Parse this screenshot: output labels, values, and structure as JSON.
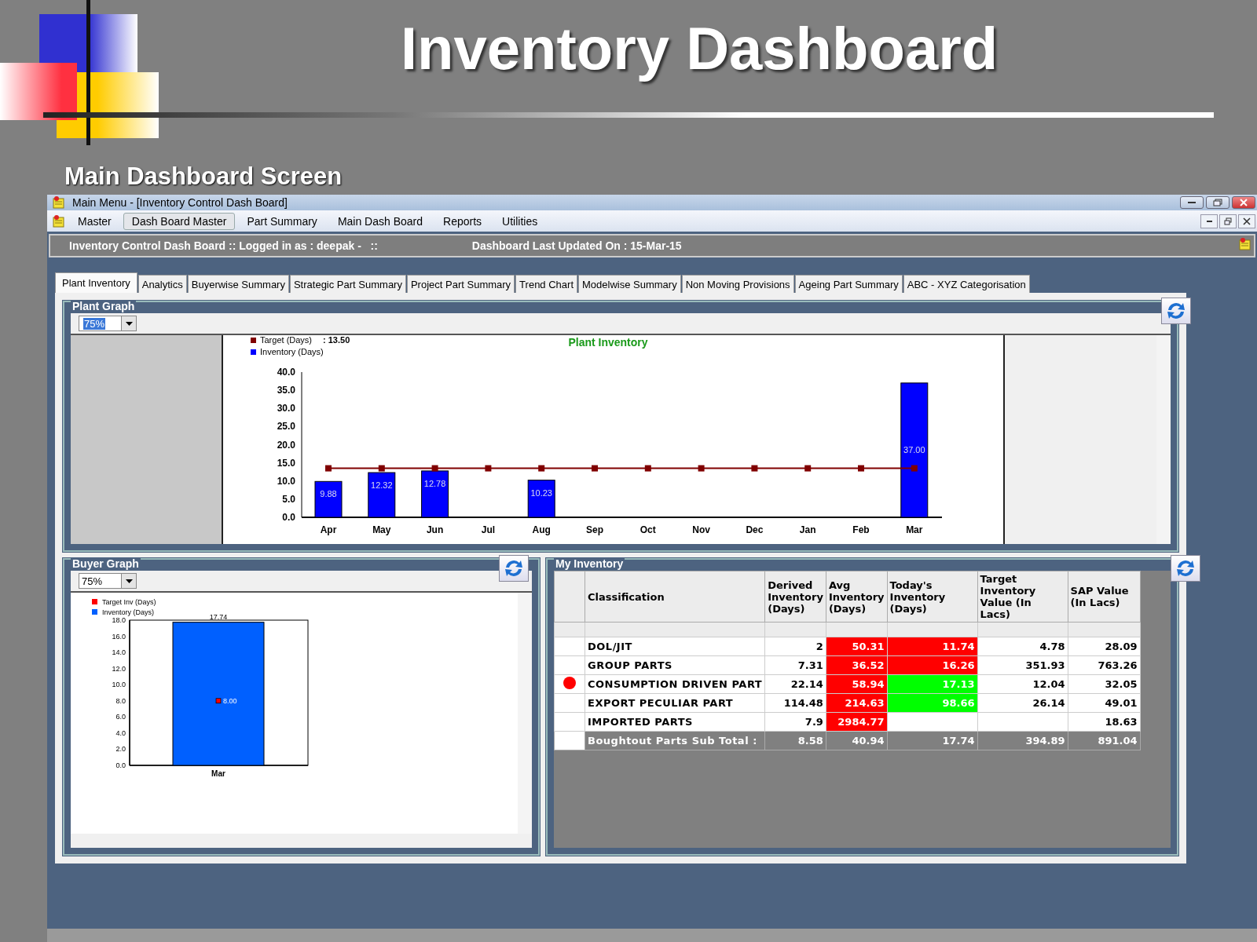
{
  "slide": {
    "title": "Inventory Dashboard",
    "subtitle": "Main Dashboard Screen"
  },
  "window": {
    "title": "Main Menu - [Inventory Control Dash Board]"
  },
  "menu": [
    {
      "label": "Master",
      "selected": false
    },
    {
      "label": "Dash Board Master",
      "selected": true
    },
    {
      "label": "Part Summary",
      "selected": false
    },
    {
      "label": "Main Dash Board",
      "selected": false
    },
    {
      "label": "Reports",
      "selected": false
    },
    {
      "label": "Utilities",
      "selected": false
    }
  ],
  "status_bar": {
    "login": "Inventory Control Dash Board :: Logged in as : deepak -   ::",
    "updated": "Dashboard Last Updated On : 15-Mar-15"
  },
  "tabs": [
    {
      "label": "Plant Inventory",
      "selected": true
    },
    {
      "label": "Analytics",
      "selected": false
    },
    {
      "label": "Buyerwise Summary",
      "selected": false
    },
    {
      "label": "Strategic Part Summary",
      "selected": false
    },
    {
      "label": "Project Part Summary",
      "selected": false
    },
    {
      "label": "Trend Chart",
      "selected": false
    },
    {
      "label": "Modelwise Summary",
      "selected": false
    },
    {
      "label": "Non Moving Provisions",
      "selected": false
    },
    {
      "label": "Ageing Part Summary",
      "selected": false
    },
    {
      "label": "ABC - XYZ Categorisation",
      "selected": false
    }
  ],
  "plant_graph": {
    "title": "Plant Graph",
    "zoom": "75%",
    "legend_values": [
      ": 13.50"
    ],
    "chart_data": {
      "type": "bar",
      "title": "Plant Inventory",
      "legend": "top left",
      "categories": [
        "Apr",
        "May",
        "Jun",
        "Jul",
        "Aug",
        "Sep",
        "Oct",
        "Nov",
        "Dec",
        "Jan",
        "Feb",
        "Mar"
      ],
      "series": [
        {
          "name": "Target (Days)",
          "color": "#800000",
          "type": "line",
          "marker": "square",
          "values": [
            13.5,
            13.5,
            13.5,
            13.5,
            13.5,
            13.5,
            13.5,
            13.5,
            13.5,
            13.5,
            13.5,
            13.5
          ]
        },
        {
          "name": "Inventory (Days)",
          "color": "#0000ff",
          "values": [
            9.88,
            12.32,
            12.78,
            null,
            10.23,
            null,
            null,
            null,
            null,
            null,
            null,
            37.0
          ],
          "value_labels": [
            "9.88",
            "12.32",
            "12.78",
            null,
            "10.23",
            null,
            null,
            null,
            null,
            null,
            null,
            "37.00"
          ]
        }
      ],
      "ylim": [
        0,
        40
      ],
      "yticks": [
        {
          "value": 0,
          "label": "0.0"
        },
        {
          "value": 5,
          "label": "5.0"
        },
        {
          "value": 10,
          "label": "10.0"
        },
        {
          "value": 15,
          "label": "15.0"
        },
        {
          "value": 20,
          "label": "20.0"
        },
        {
          "value": 25,
          "label": "25.0"
        },
        {
          "value": 30,
          "label": "30.0"
        },
        {
          "value": 35,
          "label": "35.0"
        },
        {
          "value": 40,
          "label": "40.0"
        }
      ]
    }
  },
  "buyer_graph": {
    "title": "Buyer Graph",
    "zoom": "75%",
    "chart_data": {
      "type": "bar",
      "legend": "top left",
      "categories": [
        "Mar"
      ],
      "series": [
        {
          "name": "Target Inv (Days)",
          "color": "#ff0000",
          "type": "scatter",
          "values": [
            8.0
          ],
          "value_labels": [
            "8.00"
          ]
        },
        {
          "name": "Inventory (Days)",
          "color": "#0060ff",
          "values": [
            17.74
          ],
          "value_labels": [
            "17.74"
          ]
        }
      ],
      "ylim": [
        0,
        18
      ],
      "yticks": [
        {
          "value": 0,
          "label": "0.0"
        },
        {
          "value": 2,
          "label": "2.0"
        },
        {
          "value": 4,
          "label": "4.0"
        },
        {
          "value": 6,
          "label": "6.0"
        },
        {
          "value": 8,
          "label": "8.0"
        },
        {
          "value": 10,
          "label": "10.0"
        },
        {
          "value": 12,
          "label": "12.0"
        },
        {
          "value": 14,
          "label": "14.0"
        },
        {
          "value": 16,
          "label": "16.0"
        },
        {
          "value": 18,
          "label": "18.0"
        }
      ]
    }
  },
  "my_inventory": {
    "title": "My Inventory",
    "columns": [
      "Classification",
      "Derived Inventory (Days)",
      "Avg Inventory (Days)",
      "Today's Inventory (Days)",
      "Target Inventory Value (In Lacs)",
      "SAP Value (In Lacs)"
    ],
    "rows": [
      {
        "alert": false,
        "classification": "DOL/JIT",
        "derived": "2",
        "avg": "50.31",
        "avg_over_target": true,
        "today": "11.74",
        "today_over_target": true,
        "target": "4.78",
        "sap": "28.09"
      },
      {
        "alert": false,
        "classification": "GROUP PARTS",
        "derived": "7.31",
        "avg": "36.52",
        "avg_over_target": true,
        "today": "16.26",
        "today_over_target": true,
        "target": "351.93",
        "sap": "763.26"
      },
      {
        "alert": true,
        "classification": "CONSUMPTION DRIVEN PART",
        "derived": "22.14",
        "avg": "58.94",
        "avg_over_target": true,
        "today": "17.13",
        "today_over_target": false,
        "target": "12.04",
        "sap": "32.05"
      },
      {
        "alert": false,
        "classification": "EXPORT PECULIAR PART",
        "derived": "114.48",
        "avg": "214.63",
        "avg_over_target": true,
        "today": "98.66",
        "today_over_target": false,
        "target": "26.14",
        "sap": "49.01"
      },
      {
        "alert": false,
        "classification": "IMPORTED PARTS",
        "derived": "7.9",
        "avg": "2984.77",
        "avg_over_target": true,
        "sap": "18.63"
      }
    ],
    "subtotal": {
      "label": "Boughtout Parts Sub Total :",
      "derived": "8.58",
      "avg": "40.94",
      "today": "17.74",
      "target": "394.89",
      "sap": "891.04"
    }
  }
}
